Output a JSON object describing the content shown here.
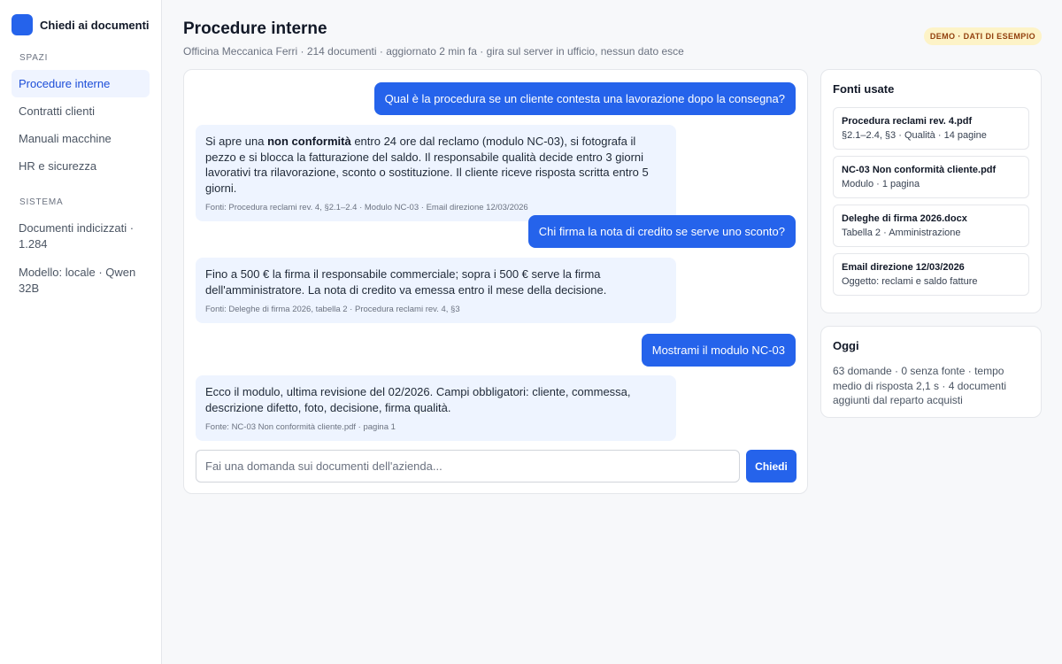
{
  "brand": {
    "name": "Chiedi ai documenti",
    "accent": "#2563eb"
  },
  "sidebar": {
    "spaces_label": "SPAZI",
    "spaces": [
      {
        "label": "Procedure interne",
        "active": true
      },
      {
        "label": "Contratti clienti",
        "active": false
      },
      {
        "label": "Manuali macchine",
        "active": false
      },
      {
        "label": "HR e sicurezza",
        "active": false
      }
    ],
    "system_label": "SISTEMA",
    "system": [
      {
        "label": "Documenti indicizzati · 1.284"
      },
      {
        "label": "Modello: locale · Qwen 32B"
      }
    ]
  },
  "header": {
    "title": "Procedure interne",
    "subtitle": "Officina Meccanica Ferri · 214 documenti · aggiornato 2 min fa · gira sul server in ufficio, nessun dato esce",
    "badge": "DEMO · DATI DI ESEMPIO"
  },
  "chat": {
    "messages": [
      {
        "role": "user",
        "text": "Qual è la procedura se un cliente contesta una lavorazione dopo la consegna?"
      },
      {
        "role": "assistant",
        "text_before": "Si apre una ",
        "text_bold": "non conformità",
        "text_after": " entro 24 ore dal reclamo (modulo NC-03), si fotografa il pezzo e si blocca la fatturazione del saldo. Il responsabile qualità decide entro 3 giorni lavorativi tra rilavorazione, sconto o sostituzione. Il cliente riceve risposta scritta entro 5 giorni.",
        "source": "Fonti: Procedura reclami rev. 4, §2.1–2.4 · Modulo NC-03 · Email direzione 12/03/2026"
      },
      {
        "role": "user",
        "text": "Chi firma la nota di credito se serve uno sconto?"
      },
      {
        "role": "assistant",
        "text": "Fino a 500 € la firma il responsabile commerciale; sopra i 500 € serve la firma dell'amministratore. La nota di credito va emessa entro il mese della decisione.",
        "source": "Fonti: Deleghe di firma 2026, tabella 2 · Procedura reclami rev. 4, §3"
      },
      {
        "role": "user",
        "text": "Mostrami il modulo NC-03"
      },
      {
        "role": "assistant",
        "text": "Ecco il modulo, ultima revisione del 02/2026. Campi obbligatori: cliente, commessa, descrizione difetto, foto, decisione, firma qualità.",
        "source": "Fonte: NC-03 Non conformità cliente.pdf · pagina 1"
      }
    ],
    "input_placeholder": "Fai una domanda sui documenti dell'azienda...",
    "input_value": "",
    "ask_label": "Chiedi"
  },
  "sources": {
    "title": "Fonti usate",
    "items": [
      {
        "name": "Procedura reclami rev. 4.pdf",
        "meta": "§2.1–2.4, §3 · Qualità · 14 pagine"
      },
      {
        "name": "NC-03 Non conformità cliente.pdf",
        "meta": "Modulo · 1 pagina"
      },
      {
        "name": "Deleghe di firma 2026.docx",
        "meta": "Tabella 2 · Amministrazione"
      },
      {
        "name": "Email direzione 12/03/2026",
        "meta": "Oggetto: reclami e saldo fatture"
      }
    ]
  },
  "today": {
    "title": "Oggi",
    "text": "63 domande · 0 senza fonte · tempo medio di risposta 2,1 s · 4 documenti aggiunti dal reparto acquisti"
  }
}
